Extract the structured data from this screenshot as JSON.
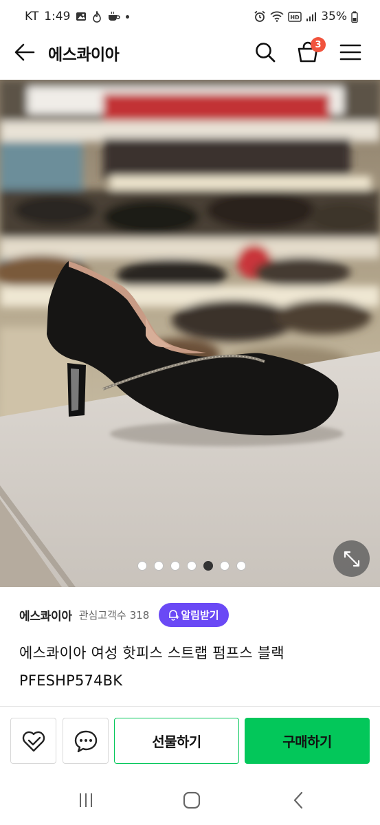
{
  "status_bar": {
    "carrier": "KT",
    "time": "1:49",
    "battery": "35%",
    "left_icons": [
      "gallery-icon",
      "fire-icon",
      "coffee-icon"
    ],
    "right_icons": [
      "alarm-icon",
      "wifi-icon",
      "hd-icon",
      "signal-icon",
      "battery-icon"
    ]
  },
  "header": {
    "title": "에스콰이아",
    "cart_count": "3",
    "icons": [
      "back-arrow-icon",
      "search-icon",
      "cart-icon",
      "menu-icon"
    ]
  },
  "gallery": {
    "total_images": 7,
    "active_index": 4,
    "description_icon": "expand-icon"
  },
  "store": {
    "name": "에스콰이아",
    "followers_label": "관심고객수",
    "followers_count": "318",
    "notify_label": "알림받기"
  },
  "product": {
    "title": "에스콰이아 여성 핫피스 스트랩 펌프스 블랙 PFESHP574BK"
  },
  "actions": {
    "gift_label": "선물하기",
    "buy_label": "구매하기"
  },
  "colors": {
    "accent_green": "#03c75a",
    "notify_purple": "#6a49f5",
    "badge_red": "#f1533d"
  }
}
